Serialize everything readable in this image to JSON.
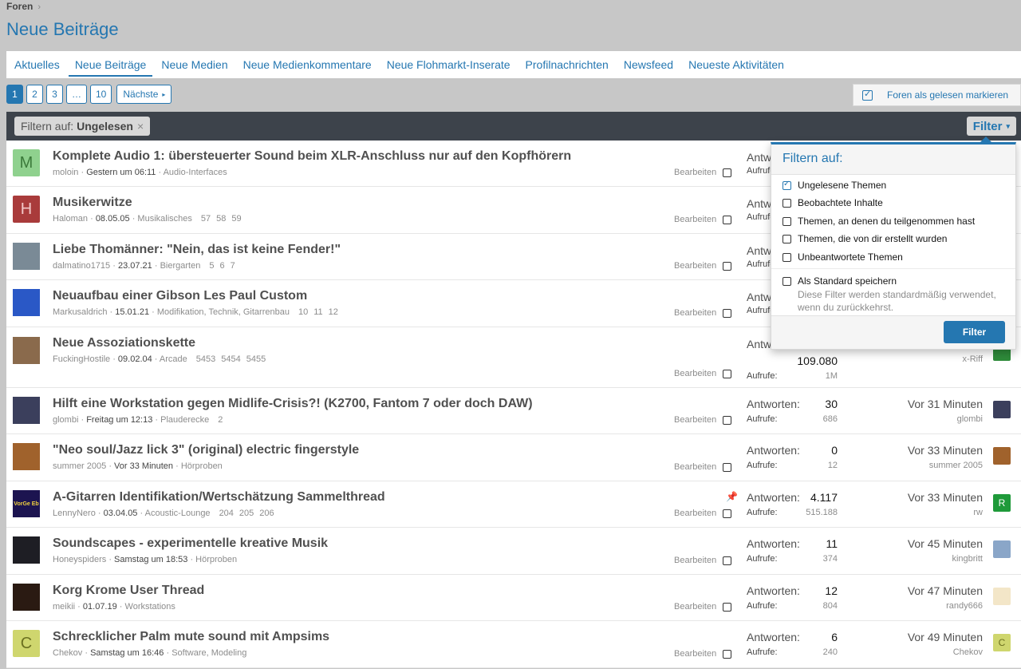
{
  "breadcrumb": {
    "item": "Foren",
    "sep": "›"
  },
  "page_title": "Neue Beiträge",
  "tabs": [
    {
      "label": "Aktuelles"
    },
    {
      "label": "Neue Beiträge"
    },
    {
      "label": "Neue Medien"
    },
    {
      "label": "Neue Medienkommentare"
    },
    {
      "label": "Neue Flohmarkt-Inserate"
    },
    {
      "label": "Profilnachrichten"
    },
    {
      "label": "Newsfeed"
    },
    {
      "label": "Neueste Aktivitäten"
    }
  ],
  "pager": {
    "p1": "1",
    "p2": "2",
    "p3": "3",
    "ellipsis": "…",
    "last": "10",
    "next": "Nächste",
    "next_arrow": "▸"
  },
  "mark_read": "Foren als gelesen markieren",
  "filterbar": {
    "prefix": "Filtern auf:",
    "value": "Ungelesen",
    "remove": "×",
    "button": "Filter",
    "caret": "▾"
  },
  "edit_label": "Bearbeiten",
  "replies_label": "Antworten:",
  "views_label": "Aufrufe:",
  "threads": [
    {
      "avatar": "M",
      "avatar_color": "#8fd18e",
      "avatar_text_color": "#3b7a3a",
      "title": "Komplete Audio 1: übersteuerter Sound beim XLR-Anschluss nur auf den Kopfhörern",
      "author": "moloin",
      "date": "Gestern um 06:11",
      "forum": "Audio-Interfaces",
      "pages": [],
      "replies": "",
      "views": "",
      "last_time": "",
      "last_user": "",
      "last_av": "",
      "last_av_color": "#ffffff"
    },
    {
      "avatar": "H",
      "avatar_color": "#a93b3b",
      "avatar_text_color": "#f2c8c8",
      "title": "Musikerwitze",
      "author": "Haloman",
      "date": "08.05.05",
      "forum": "Musikalisches",
      "pages": [
        "57",
        "58",
        "59"
      ],
      "replies": "",
      "views": "",
      "last_time": "",
      "last_user": "",
      "last_av": "",
      "last_av_color": "#ffffff"
    },
    {
      "avatar": "",
      "avatar_color": "#7a8a96",
      "avatar_text_color": "#fff",
      "title": "Liebe Thomänner: \"Nein, das ist keine Fender!\"",
      "author": "dalmatino1715",
      "date": "23.07.21",
      "forum": "Biergarten",
      "pages": [
        "5",
        "6",
        "7"
      ],
      "replies": "",
      "views": "",
      "last_time": "",
      "last_user": "",
      "last_av": "",
      "last_av_color": "#ffffff"
    },
    {
      "avatar": "",
      "avatar_color": "#2a58c6",
      "avatar_text_color": "#fff",
      "title": "Neuaufbau einer Gibson Les Paul Custom",
      "author": "Markusaldrich",
      "date": "15.01.21",
      "forum": "Modifikation, Technik, Gitarrenbau",
      "pages": [
        "10",
        "11",
        "12"
      ],
      "replies": "",
      "views": "",
      "last_time": "",
      "last_user": "",
      "last_av": "",
      "last_av_color": "#ffffff"
    },
    {
      "avatar": "",
      "avatar_color": "#8a6a4c",
      "avatar_text_color": "#fff",
      "title": "Neue Assoziationskette",
      "author": "FuckingHostile",
      "date": "09.02.04",
      "forum": "Arcade",
      "pages": [
        "5453",
        "5454",
        "5455"
      ],
      "replies": "109.080",
      "views": "1M",
      "last_time": "",
      "last_user": "x-Riff",
      "last_av": "",
      "last_av_color": "#2e8b3a"
    },
    {
      "avatar": "",
      "avatar_color": "#3b3f5c",
      "avatar_text_color": "#fff",
      "title": "Hilft eine Workstation gegen Midlife-Crisis?! (K2700, Fantom 7 oder doch DAW)",
      "author": "glombi",
      "date": "Freitag um 12:13",
      "forum": "Plauderecke",
      "pages": [
        "2"
      ],
      "replies": "30",
      "views": "686",
      "last_time": "Vor 31 Minuten",
      "last_user": "glombi",
      "last_av": "",
      "last_av_color": "#3b3f5c"
    },
    {
      "avatar": "",
      "avatar_color": "#a0622c",
      "avatar_text_color": "#fff",
      "title": "\"Neo soul/Jazz lick 3\" (original) electric fingerstyle",
      "author": "summer 2005",
      "date": "Vor 33 Minuten",
      "forum": "Hörproben",
      "pages": [],
      "replies": "0",
      "views": "12",
      "last_time": "Vor 33 Minuten",
      "last_user": "summer 2005",
      "last_av": "",
      "last_av_color": "#a0622c"
    },
    {
      "avatar": "VorGe Eb",
      "avatar_color": "#1c1450",
      "avatar_text_color": "#f0d040",
      "title": "A-Gitarren Identifikation/Wertschätzung Sammelthread",
      "author": "LennyNero",
      "date": "03.04.05",
      "forum": "Acoustic-Lounge",
      "pages": [
        "204",
        "205",
        "206"
      ],
      "replies": "4.117",
      "views": "515.188",
      "last_time": "Vor 33 Minuten",
      "last_user": "rw",
      "last_av": "R",
      "last_av_color": "#1f9a3a",
      "pinned": true
    },
    {
      "avatar": "",
      "avatar_color": "#1e1e24",
      "avatar_text_color": "#fff",
      "title": "Soundscapes - experimentelle kreative Musik",
      "author": "Honeyspiders",
      "date": "Samstag um 18:53",
      "forum": "Hörproben",
      "pages": [],
      "replies": "11",
      "views": "374",
      "last_time": "Vor 45 Minuten",
      "last_user": "kingbritt",
      "last_av": "",
      "last_av_color": "#8aa6c8"
    },
    {
      "avatar": "",
      "avatar_color": "#2a1a12",
      "avatar_text_color": "#fff",
      "title": "Korg Krome User Thread",
      "author": "meikii",
      "date": "01.07.19",
      "forum": "Workstations",
      "pages": [],
      "replies": "12",
      "views": "804",
      "last_time": "Vor 47 Minuten",
      "last_user": "randy666",
      "last_av": "",
      "last_av_color": "#f3e6c8"
    },
    {
      "avatar": "C",
      "avatar_color": "#cfd66e",
      "avatar_text_color": "#6b7020",
      "title": "Schrecklicher Palm mute sound mit Ampsims",
      "author": "Chekov",
      "date": "Samstag um 16:46",
      "forum": "Software, Modeling",
      "pages": [],
      "replies": "6",
      "views": "240",
      "last_time": "Vor 49 Minuten",
      "last_user": "Chekov",
      "last_av": "C",
      "last_av_color": "#cfd66e"
    }
  ],
  "row3_partial": {
    "views_partial": "Aufrufe"
  },
  "popup": {
    "title": "Filtern auf:",
    "options": [
      {
        "label": "Ungelesene Themen",
        "checked": true
      },
      {
        "label": "Beobachtete Inhalte",
        "checked": false
      },
      {
        "label": "Themen, an denen du teilgenommen hast",
        "checked": false
      },
      {
        "label": "Themen, die von dir erstellt wurden",
        "checked": false
      },
      {
        "label": "Unbeantwortete Themen",
        "checked": false
      }
    ],
    "save_default": "Als Standard speichern",
    "hint": "Diese Filter werden standardmäßig verwendet, wenn du zurückkehrst.",
    "apply": "Filter"
  },
  "partial_labels": {
    "replies_cut": "Antw",
    "views_cut": "Aufrufe"
  }
}
